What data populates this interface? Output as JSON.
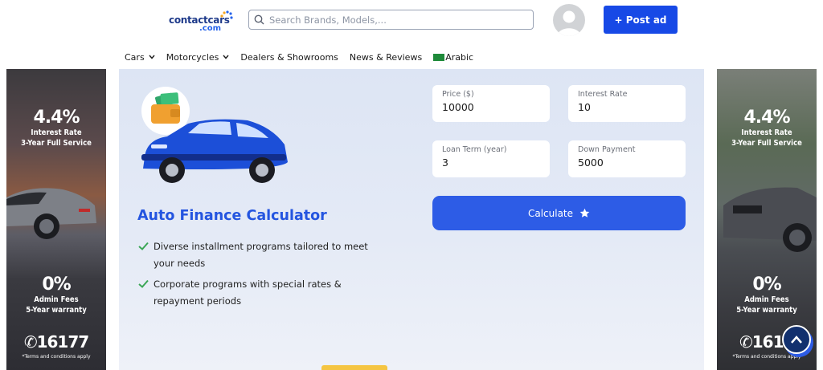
{
  "header": {
    "logo_main": "contactcars",
    "logo_sub": ".com",
    "search_placeholder": "Search Brands, Models,...",
    "post_ad_label": "+ Post ad"
  },
  "nav": {
    "items": [
      {
        "label": "Cars",
        "has_dropdown": true
      },
      {
        "label": "Motorcycles",
        "has_dropdown": true
      },
      {
        "label": "Dealers & Showrooms",
        "has_dropdown": false
      },
      {
        "label": "News & Reviews",
        "has_dropdown": false
      }
    ],
    "language_label": "Arabic"
  },
  "ads": {
    "rate": "4.4%",
    "rate_line1": "Interest Rate",
    "rate_line2": "3-Year Full Service",
    "fees": "0%",
    "fees_line1": "Admin Fees",
    "fees_line2": "5-Year warranty",
    "phone": "16177",
    "phone_right": "1617",
    "terms": "*Terms and conditions apply"
  },
  "calculator": {
    "title": "Auto Finance Calculator",
    "features": [
      "Diverse installment programs tailored to meet your needs",
      "Corporate programs with special rates & repayment periods"
    ],
    "fields": {
      "price": {
        "label": "Price ($)",
        "value": "10000"
      },
      "interest_rate": {
        "label": "Interest Rate",
        "value": "10"
      },
      "loan_term": {
        "label": "Loan Term (year)",
        "value": "3"
      },
      "down_payment": {
        "label": "Down Payment",
        "value": "5000"
      }
    },
    "button_label": "Calculate"
  },
  "colors": {
    "brand_blue": "#1749e6",
    "accent_blue": "#2d5ce6",
    "title_blue": "#2455e0",
    "check_green": "#3aa655"
  },
  "icons": {
    "search": "search-icon",
    "avatar": "user-avatar-icon",
    "chevron": "chevron-down-icon",
    "check": "check-icon",
    "star": "star-icon",
    "scroll_top": "chevron-up-icon"
  }
}
